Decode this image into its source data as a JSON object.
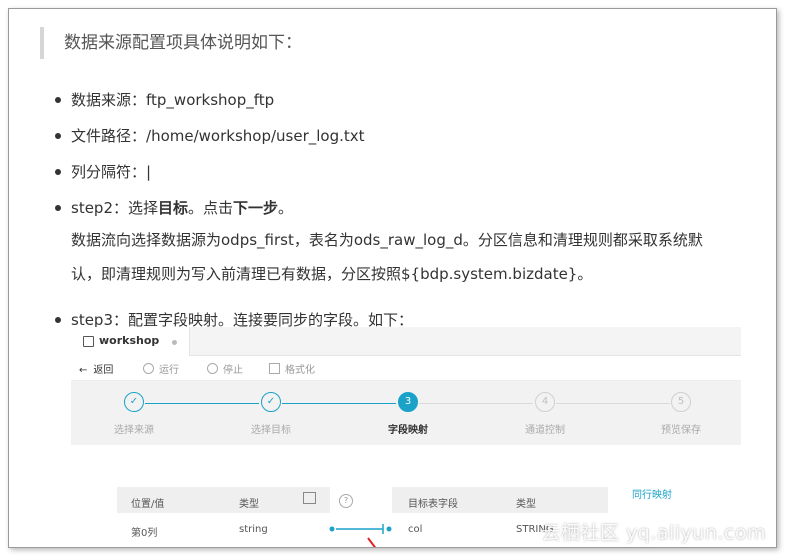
{
  "intro": "数据来源配置项具体说明如下：",
  "bullets": [
    {
      "label": "数据来源：",
      "value": "ftp_workshop_ftp"
    },
    {
      "label": "文件路径：",
      "value": "/home/workshop/user_log.txt"
    },
    {
      "label": "列分隔符：",
      "value": "|"
    }
  ],
  "step2": {
    "prefix": "step2：选择",
    "bold1": "目标",
    "mid": "。点击",
    "bold2": "下一步",
    "suffix": "。",
    "desc_line1": "数据流向选择数据源为odps_first，表名为ods_raw_log_d。分区信息和清理规则都采取系统默",
    "desc_line2": "认，即清理规则为写入前清理已有数据，分区按照${bdp.system.bizdate}。"
  },
  "step3": {
    "text": "step3：配置字段映射。连接要同步的字段。如下："
  },
  "screenshot": {
    "tab_name": "workshop",
    "toolbar": {
      "back": "返回",
      "run": "运行",
      "stop": "停止",
      "format": "格式化"
    },
    "steps": [
      {
        "label": "选择来源",
        "num": "✓",
        "state": "done"
      },
      {
        "label": "选择目标",
        "num": "✓",
        "state": "done"
      },
      {
        "label": "字段映射",
        "num": "3",
        "state": "active"
      },
      {
        "label": "通道控制",
        "num": "4",
        "state": "todo"
      },
      {
        "label": "预览保存",
        "num": "5",
        "state": "todo"
      }
    ],
    "source_table": {
      "headers": [
        "位置/值",
        "类型"
      ],
      "row": [
        "第0列",
        "string"
      ]
    },
    "target_table": {
      "headers": [
        "目标表字段",
        "类型"
      ],
      "row": [
        "col",
        "STRING"
      ]
    },
    "help_icon": "?",
    "sync_link": "同行映射"
  },
  "watermark": "云栖社区 yq.aliyun.com",
  "colors": {
    "accent": "#1aa2c9",
    "border": "#9a9a9a",
    "mapping_line": "#1aa2c9"
  }
}
